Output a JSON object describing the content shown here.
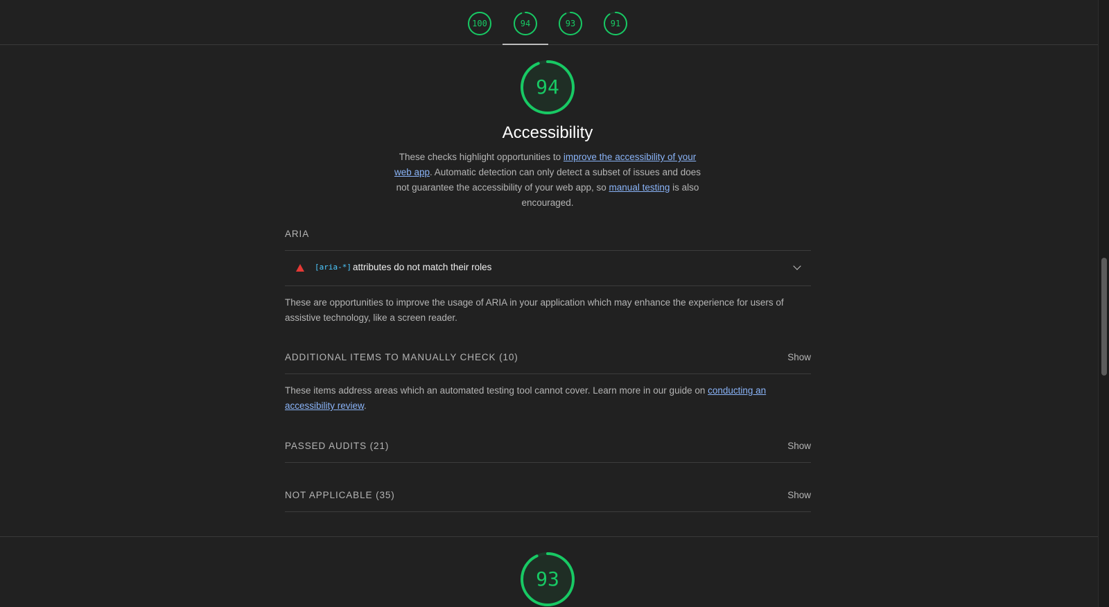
{
  "score_tabs": [
    {
      "score": "100",
      "value": 1.0
    },
    {
      "score": "94",
      "value": 0.94
    },
    {
      "score": "93",
      "value": 0.93
    },
    {
      "score": "91",
      "value": 0.91
    }
  ],
  "active_tab_index": 1,
  "colors": {
    "pass": "#18c964",
    "fail": "#e53935",
    "link": "#8ab4f8",
    "background": "#212121"
  },
  "category": {
    "score": "94",
    "score_value": 0.94,
    "title": "Accessibility",
    "desc_part1": "These checks highlight opportunities to ",
    "desc_link1": "improve the accessibility of your web app",
    "desc_part2": ". Automatic detection can only detect a subset of issues and does not guarantee the accessibility of your web app, so ",
    "desc_link2": "manual testing",
    "desc_part3": " is also encouraged."
  },
  "aria_group": {
    "title": "ARIA",
    "audit": {
      "icon": "fail-triangle-icon",
      "code": "[aria-*]",
      "text": "attributes do not match their roles"
    },
    "description": "These are opportunities to improve the usage of ARIA in your application which may enhance the experience for users of assistive technology, like a screen reader."
  },
  "manual_group": {
    "title": "ADDITIONAL ITEMS TO MANUALLY CHECK",
    "count": "(10)",
    "show_label": "Show",
    "desc_part1": "These items address areas which an automated testing tool cannot cover. Learn more in our guide on ",
    "desc_link": "conducting an accessibility review",
    "desc_part2": "."
  },
  "passed_group": {
    "title": "PASSED AUDITS",
    "count": "(21)",
    "show_label": "Show"
  },
  "na_group": {
    "title": "NOT APPLICABLE",
    "count": "(35)",
    "show_label": "Show"
  },
  "next_category": {
    "score": "93",
    "score_value": 0.93
  }
}
